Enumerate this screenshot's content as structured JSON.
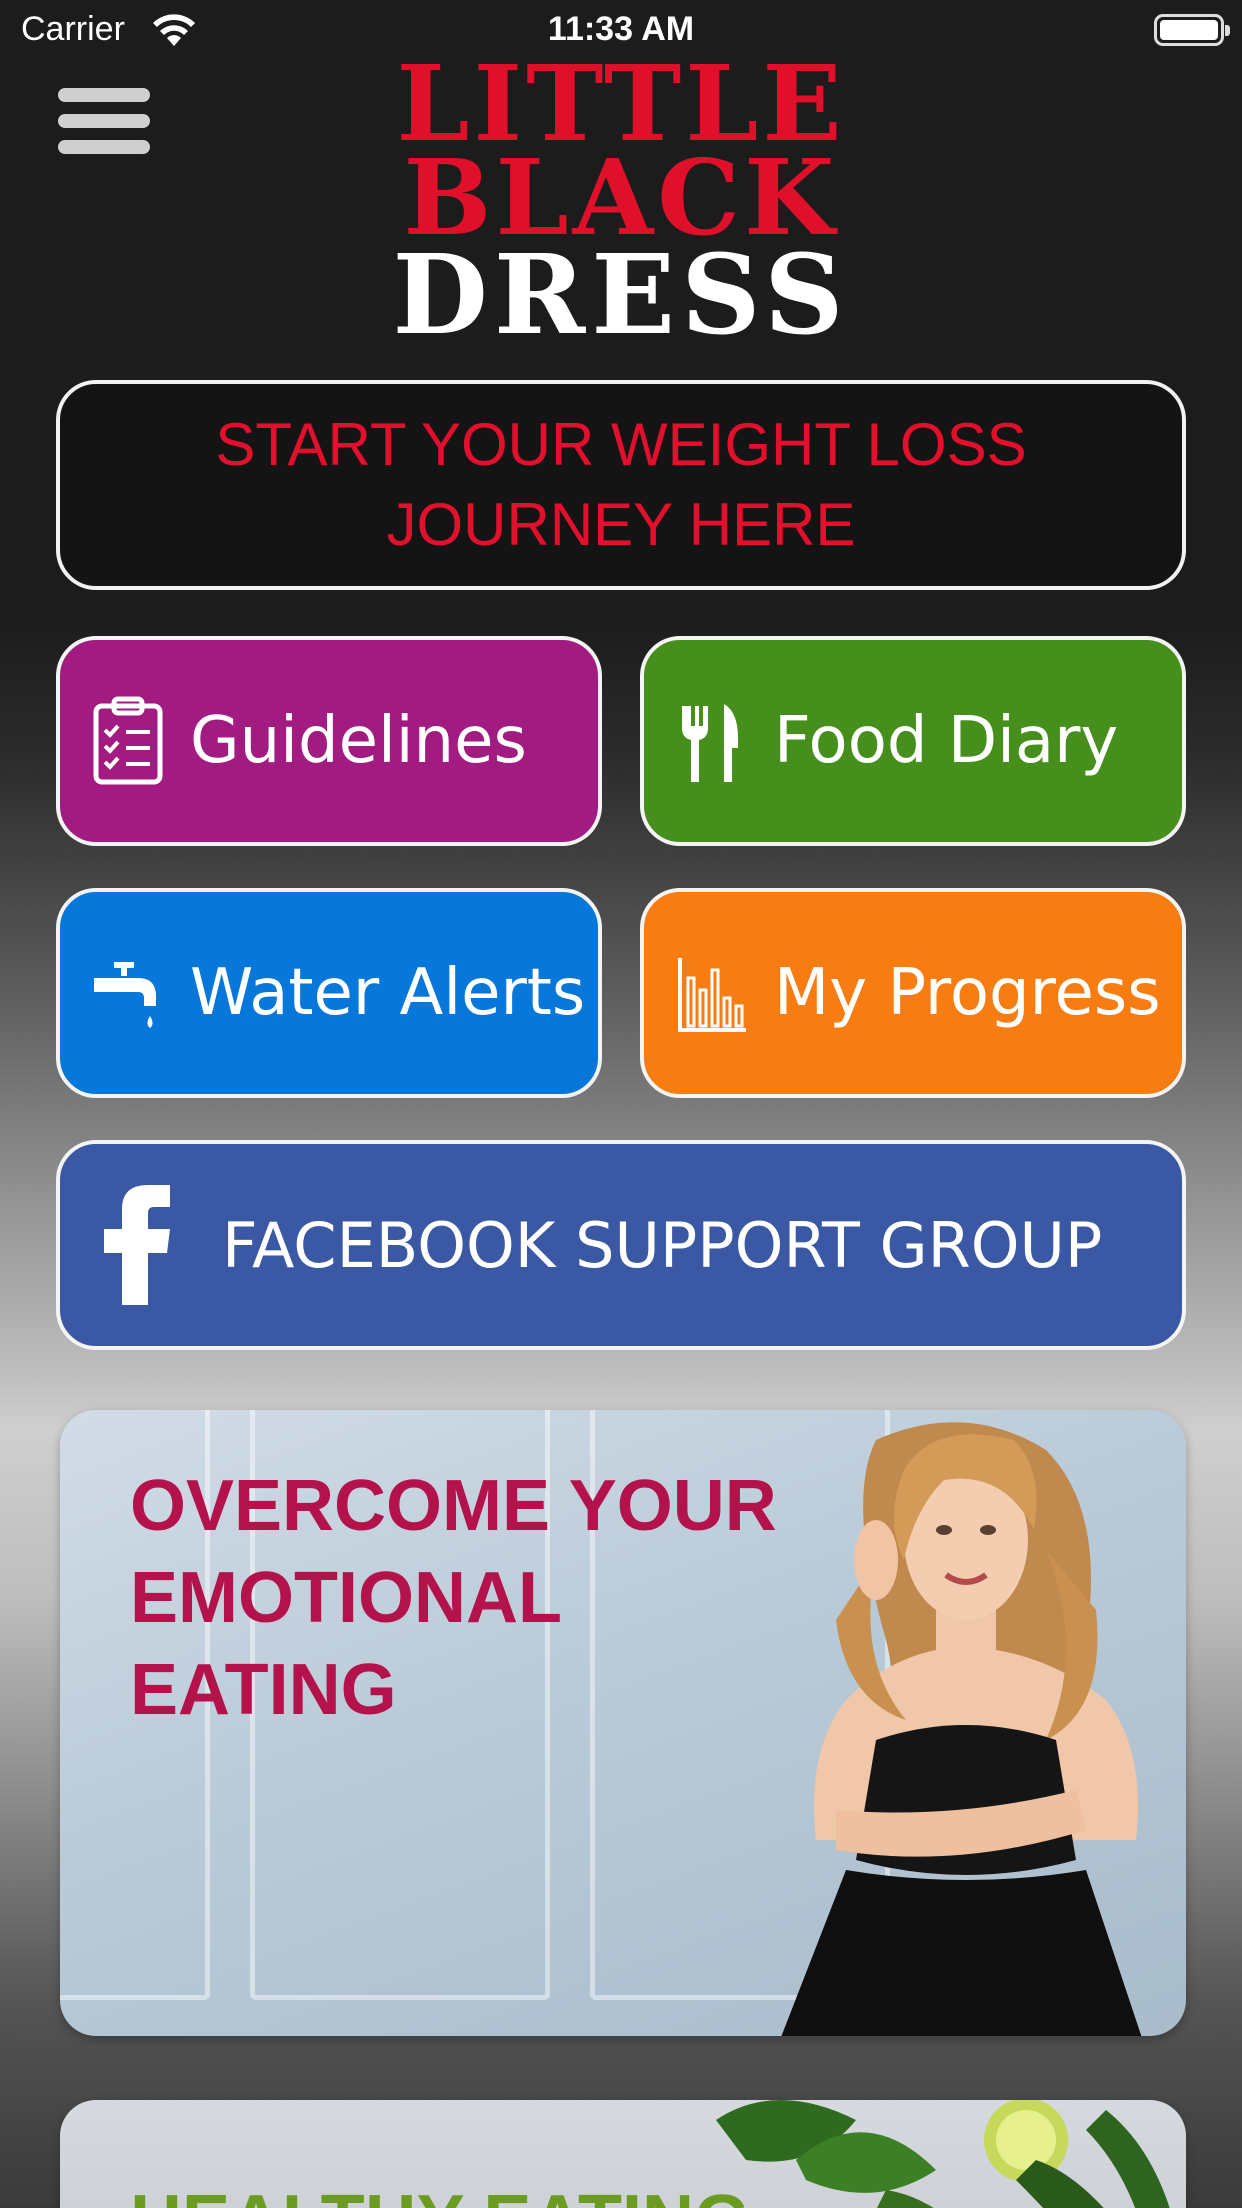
{
  "status_bar": {
    "carrier": "Carrier",
    "time": "11:33 AM"
  },
  "header": {
    "logo_line1": "LITTLE",
    "logo_line2": "BLACK",
    "logo_line3": "DRESS",
    "menu_icon": "hamburger-menu-icon"
  },
  "cta": {
    "label": "START YOUR WEIGHT LOSS JOURNEY HERE"
  },
  "tiles": [
    {
      "label": "Guidelines",
      "icon": "clipboard-checklist-icon",
      "color": "#a11b80"
    },
    {
      "label": "Food Diary",
      "icon": "fork-knife-icon",
      "color": "#468f1c"
    },
    {
      "label": "Water Alerts",
      "icon": "water-tap-icon",
      "color": "#0777d9"
    },
    {
      "label": "My Progress",
      "icon": "bar-chart-icon",
      "color": "#f77c11"
    }
  ],
  "facebook": {
    "label": "FACEBOOK SUPPORT GROUP",
    "icon": "facebook-icon",
    "color": "#3a58a3"
  },
  "banners": [
    {
      "title": "OVERCOME YOUR\nEMOTIONAL\nEATING",
      "title_color": "#b3134a"
    },
    {
      "title": "HEALTHY EATING",
      "title_color": "#6c9b22"
    }
  ],
  "colors": {
    "accent_red": "#e0102a"
  }
}
